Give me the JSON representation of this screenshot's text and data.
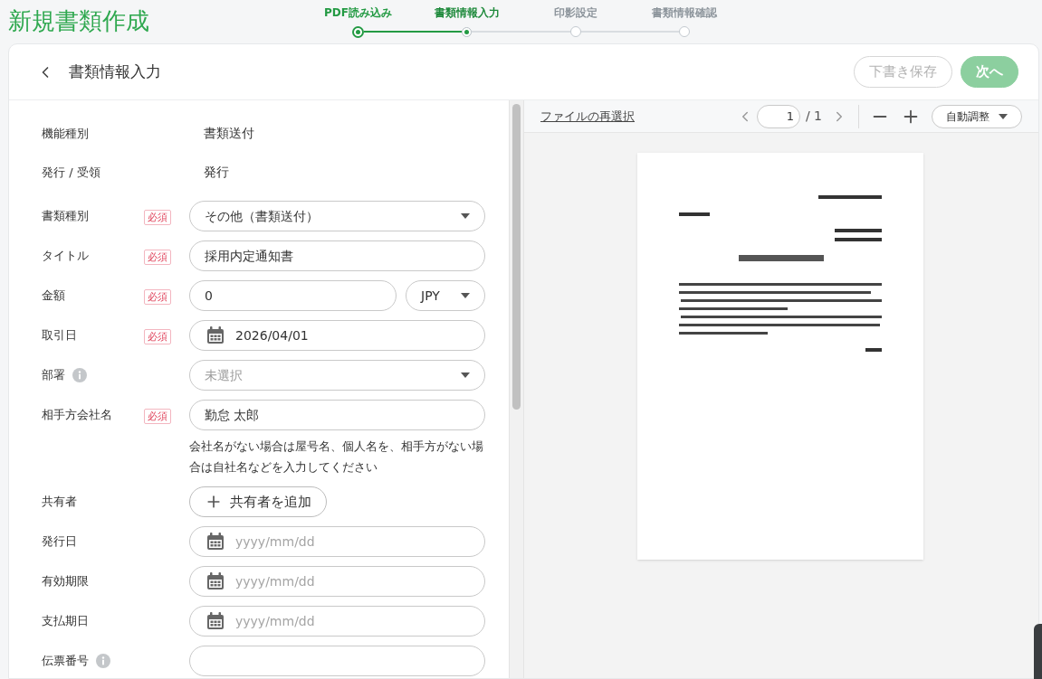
{
  "header": {
    "title": "新規書類作成"
  },
  "steps": [
    {
      "label": "PDF読み込み",
      "completed": true,
      "selected": false
    },
    {
      "label": "書類情報入力",
      "completed": false,
      "selected": true
    },
    {
      "label": "印影設定",
      "completed": false,
      "selected": false
    },
    {
      "label": "書類情報確認",
      "completed": false,
      "selected": false
    }
  ],
  "card": {
    "title": "書類情報入力",
    "buttons": [
      {
        "label": "下書き保存",
        "kind": "outline",
        "disabled": true
      },
      {
        "label": "次へ",
        "kind": "primary",
        "disabled": true
      }
    ]
  },
  "form": {
    "rows": [
      {
        "label": "機能種別",
        "kind": "static",
        "value": "書類送付"
      },
      {
        "label": "発行 / 受領",
        "kind": "static",
        "value": "発行"
      },
      {
        "label": "書類種別",
        "badge": "必須",
        "kind": "select",
        "value": "その他（書類送付）"
      },
      {
        "label": "タイトル",
        "badge": "必須",
        "kind": "text",
        "value": "採用内定通知書"
      },
      {
        "label": "金額",
        "badge": "必須",
        "kind": "amount",
        "value": "0",
        "currency": "JPY"
      },
      {
        "label": "取引日",
        "badge": "必須",
        "kind": "date",
        "value": "2026/04/01"
      },
      {
        "label": "部署",
        "info": true,
        "kind": "select",
        "placeholder": "未選択"
      },
      {
        "label": "相手方会社名",
        "badge": "必須",
        "kind": "text",
        "value": "勤怠 太郎",
        "help": "会社名がない場合は屋号名、個人名を、相手方がない場合は自社名などを入力してください"
      },
      {
        "label": "共有者",
        "kind": "add",
        "button": "共有者を追加"
      },
      {
        "label": "発行日",
        "kind": "date",
        "placeholder": "yyyy/mm/dd"
      },
      {
        "label": "有効期限",
        "kind": "date",
        "placeholder": "yyyy/mm/dd"
      },
      {
        "label": "支払期日",
        "kind": "date",
        "placeholder": "yyyy/mm/dd"
      },
      {
        "label": "伝票番号",
        "info": true,
        "kind": "text"
      }
    ]
  },
  "viewer": {
    "reselect_link": "ファイルの再選択",
    "page": "1",
    "page_total": "/ 1",
    "zoom": "自動調整"
  }
}
